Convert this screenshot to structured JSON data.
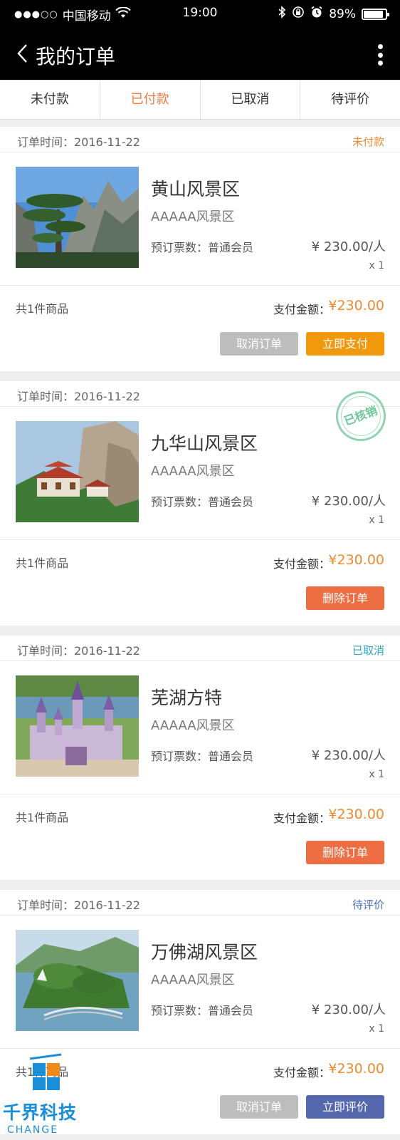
{
  "status_bar": {
    "signal": "●●●○○",
    "carrier": "中国移动",
    "time": "19:00",
    "battery": "89%",
    "battery_level": 0.89
  },
  "nav": {
    "title": "我的订单"
  },
  "tabs": [
    {
      "label": "未付款",
      "active": false
    },
    {
      "label": "已付款",
      "active": true
    },
    {
      "label": "已取消",
      "active": false
    },
    {
      "label": "待评价",
      "active": false
    }
  ],
  "orders": [
    {
      "time": "订单时间：2016-11-22",
      "status": "未付款",
      "status_color": "#ef8a2e",
      "name": "黄山风景区",
      "level": "AAAAA风景区",
      "ticket": "预订票数：普通会员",
      "price": "¥ 230.00/人",
      "qty": "x 1",
      "count": "共1件商品",
      "pay_label": "支付金额：",
      "pay_amount": "¥230.00",
      "btn1": "取消订单",
      "btn2": "立即支付"
    },
    {
      "time": "订单时间：2016-11-22",
      "stamp": "已核销",
      "name": "九华山风景区",
      "level": "AAAAA风景区",
      "ticket": "预订票数：普通会员",
      "price": "¥ 230.00/人",
      "qty": "x 1",
      "count": "共1件商品",
      "pay_label": "支付金额：",
      "pay_amount": "¥230.00",
      "btn2": "删除订单"
    },
    {
      "time": "订单时间：2016-11-22",
      "status": "已取消",
      "status_color": "#2aa4c8",
      "name": "芜湖方特",
      "level": "AAAAA风景区",
      "ticket": "预订票数：普通会员",
      "price": "¥ 230.00/人",
      "qty": "x 1",
      "count": "共1件商品",
      "pay_label": "支付金额：",
      "pay_amount": "¥230.00",
      "btn2": "删除订单"
    },
    {
      "time": "订单时间：2016-11-22",
      "status": "待评价",
      "status_color": "#4a6fb5",
      "name": "万佛湖风景区",
      "level": "AAAAA风景区",
      "ticket": "预订票数：普通会员",
      "price": "¥ 230.00/人",
      "qty": "x 1",
      "count": "共1件商品",
      "pay_label": "支付金额：",
      "pay_amount": "¥230.00",
      "btn1": "取消订单",
      "btn2": "立即评价"
    }
  ],
  "watermark": {
    "brand": "千界科技",
    "sub": "CHANGE"
  },
  "colors": {
    "accent_orange": "#ef7a3d",
    "pay_orange": "#f2980c",
    "delete_red": "#ed6e43",
    "review_blue": "#5568ad",
    "cancel_gray": "#bdbdbd",
    "stamp_green": "#6cc69a"
  }
}
